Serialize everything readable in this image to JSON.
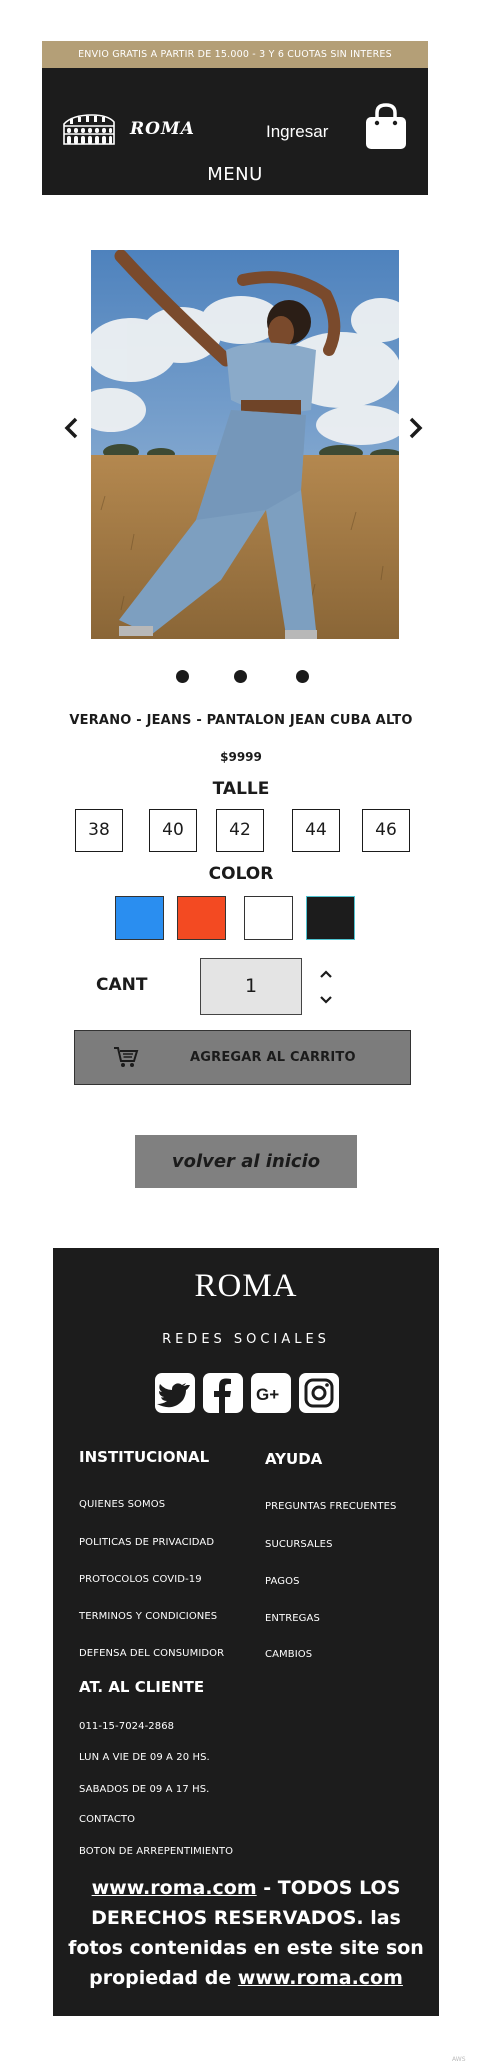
{
  "header": {
    "promo": "ENVIO GRATIS A PARTIR DE 15.000 - 3 Y 6 CUOTAS SIN INTERES",
    "logo_text": "ROMA",
    "login_label": "Ingresar",
    "cart_icon": "shopping-bag-icon",
    "menu_label": "MENU",
    "logo_icon": "colosseum-icon"
  },
  "gallery": {
    "prev_icon": "chevron-left-icon",
    "next_icon": "chevron-right-icon",
    "slide_count": 3
  },
  "product": {
    "title": "VERANO - JEANS - PANTALON JEAN CUBA ALTO",
    "price": "$9999",
    "size_label": "TALLE",
    "sizes": [
      "38",
      "40",
      "42",
      "44",
      "46"
    ],
    "color_label": "COLOR",
    "colors": [
      "#2a8ef0",
      "#f34a22",
      "#ffffff",
      "#1c1c1c"
    ],
    "qty_label": "CANT",
    "qty_value": "1",
    "add_to_cart_label": "AGREGAR AL CARRITO",
    "back_label": "volver al inicio"
  },
  "footer": {
    "brand": "ROMA",
    "social_title": "REDES SOCIALES",
    "social_icons": [
      "twitter-icon",
      "facebook-icon",
      "google-plus-icon",
      "instagram-icon"
    ],
    "institucional": {
      "heading": "INSTITUCIONAL",
      "links": [
        "QUIENES SOMOS",
        "POLITICAS DE PRIVACIDAD",
        "PROTOCOLOS COVID-19",
        "TERMINOS Y CONDICIONES",
        "DEFENSA DEL CONSUMIDOR"
      ]
    },
    "ayuda": {
      "heading": "AYUDA",
      "links": [
        "PREGUNTAS FRECUENTES",
        "SUCURSALES",
        "PAGOS",
        "ENTREGAS",
        "CAMBIOS"
      ]
    },
    "cliente": {
      "heading": "AT. AL CLIENTE",
      "links": [
        "011-15-7024-2868",
        "LUN A VIE DE 09 A 20 HS.",
        "SABADOS DE 09 A 17 HS.",
        "CONTACTO",
        "BOTON DE ARREPENTIMIENTO"
      ]
    },
    "copyright": {
      "link1": "www.roma.com",
      "text": " - TODOS LOS DERECHOS RESERVADOS. las fotos contenidas en este site son propiedad de ",
      "link2": "www.roma.com"
    }
  },
  "corner_text": "AWS"
}
